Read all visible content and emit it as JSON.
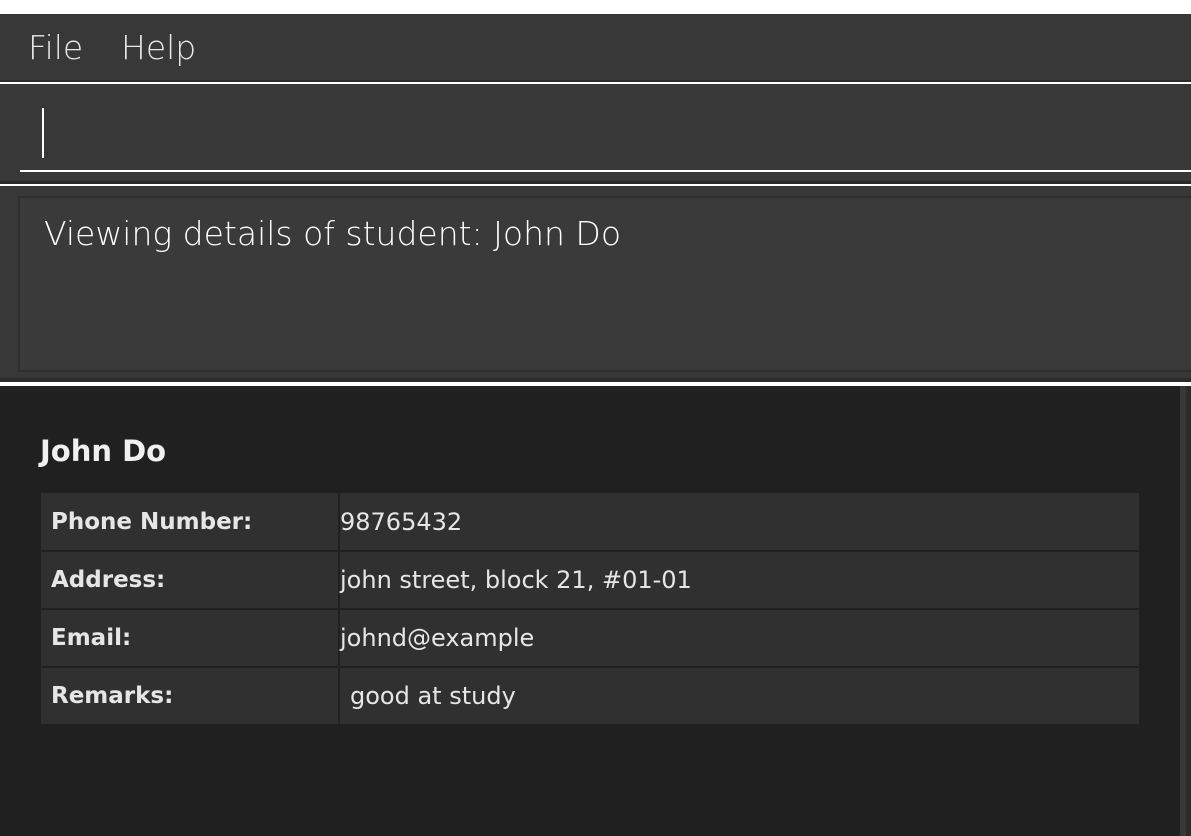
{
  "menu": {
    "file": "File",
    "help": "Help"
  },
  "command": {
    "value": ""
  },
  "result": {
    "text": "Viewing details of student: John Do"
  },
  "student": {
    "name": "John Do",
    "fields": [
      {
        "label": "Phone Number:",
        "value": "98765432"
      },
      {
        "label": "Address:",
        "value": "john street, block 21, #01-01"
      },
      {
        "label": "Email:",
        "value": "johnd@example"
      },
      {
        "label": "Remarks:",
        "value": "good at study"
      }
    ]
  }
}
